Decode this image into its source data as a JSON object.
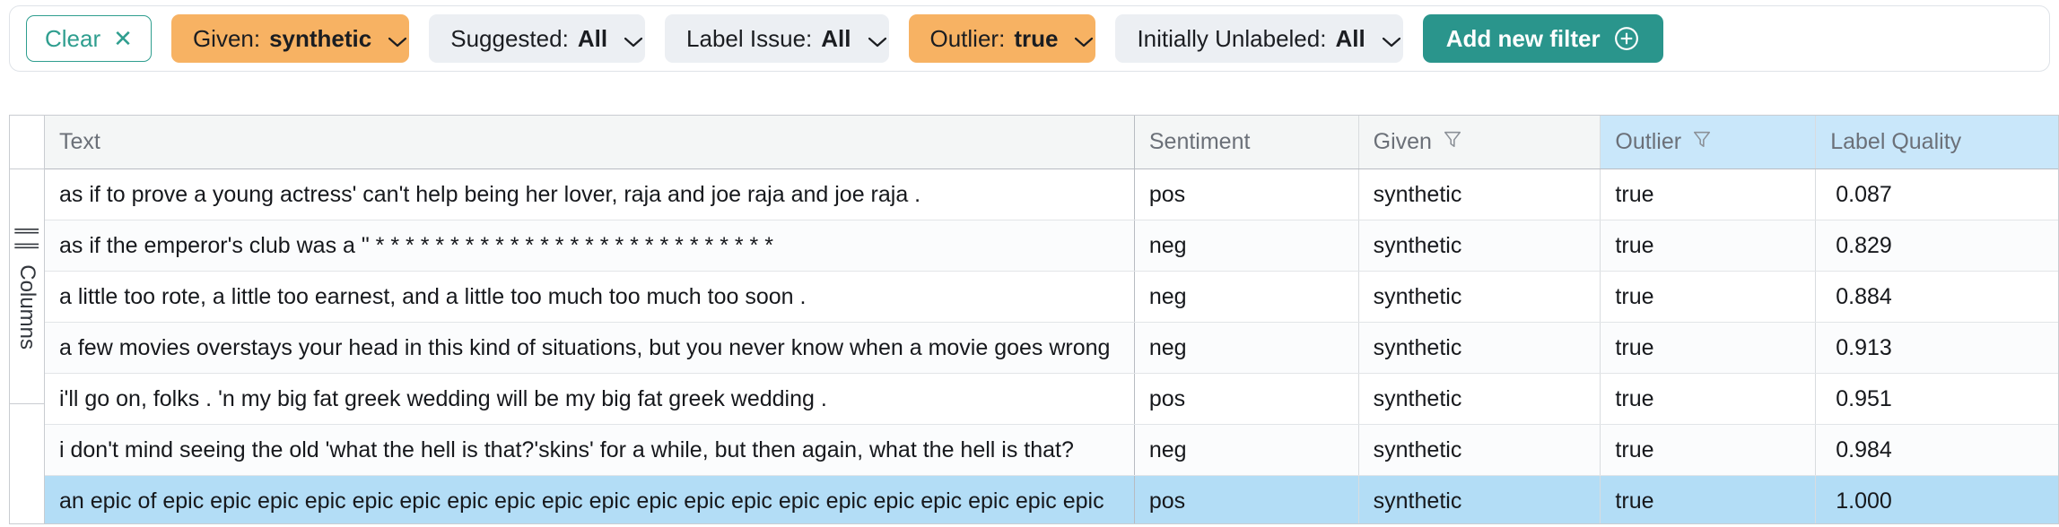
{
  "filter_bar": {
    "clear": {
      "label": "Clear",
      "icon": "close-icon"
    },
    "chips": [
      {
        "label": "Given:",
        "value": "synthetic",
        "state": "active"
      },
      {
        "label": "Suggested:",
        "value": "All",
        "state": "neutral"
      },
      {
        "label": "Label Issue:",
        "value": "All",
        "state": "neutral"
      },
      {
        "label": "Outlier:",
        "value": "true",
        "state": "active"
      },
      {
        "label": "Initially Unlabeled:",
        "value": "All",
        "state": "neutral"
      }
    ],
    "add_filter": {
      "label": "Add new filter",
      "icon": "plus-circle-icon"
    }
  },
  "side_rail": {
    "label": "Columns",
    "icon": "columns-bars-icon"
  },
  "table": {
    "columns": [
      {
        "key": "text",
        "label": "Text",
        "filtered": false,
        "highlighted": false
      },
      {
        "key": "sentiment",
        "label": "Sentiment",
        "filtered": false,
        "highlighted": false
      },
      {
        "key": "given",
        "label": "Given",
        "filtered": true,
        "highlighted": false
      },
      {
        "key": "outlier",
        "label": "Outlier",
        "filtered": true,
        "highlighted": true
      },
      {
        "key": "quality",
        "label": "Label Quality",
        "filtered": false,
        "highlighted": true
      }
    ],
    "rows": [
      {
        "text": "as if to prove a young actress' can't help being her lover, raja and joe raja and joe raja .",
        "sentiment": "pos",
        "given": "synthetic",
        "outlier": "true",
        "quality": "0.087",
        "selected": false
      },
      {
        "text": "as if the emperor's club was a \" * * * * * * * * * * * * * * * * * * * * * * * * * * *",
        "sentiment": "neg",
        "given": "synthetic",
        "outlier": "true",
        "quality": "0.829",
        "selected": false
      },
      {
        "text": "a little too rote, a little too earnest, and a little too much too much too soon .",
        "sentiment": "neg",
        "given": "synthetic",
        "outlier": "true",
        "quality": "0.884",
        "selected": false
      },
      {
        "text": "a few movies overstays your head in this kind of situations, but you never know when a movie goes wrong",
        "sentiment": "neg",
        "given": "synthetic",
        "outlier": "true",
        "quality": "0.913",
        "selected": false
      },
      {
        "text": "i'll go on, folks . 'n my big fat greek wedding will be my big fat greek wedding .",
        "sentiment": "pos",
        "given": "synthetic",
        "outlier": "true",
        "quality": "0.951",
        "selected": false
      },
      {
        "text": "i don't mind seeing the old 'what the hell is that?'skins' for a while, but then again, what the hell is that?",
        "sentiment": "neg",
        "given": "synthetic",
        "outlier": "true",
        "quality": "0.984",
        "selected": false
      },
      {
        "text": "an epic of epic epic epic epic epic epic epic epic epic epic epic epic epic epic epic epic epic epic epic epic",
        "sentiment": "pos",
        "given": "synthetic",
        "outlier": "true",
        "quality": "1.000",
        "selected": true
      }
    ]
  },
  "colors": {
    "accent_teal": "#2a958c",
    "chip_active": "#f7b263",
    "chip_neutral": "#eceff3",
    "selected_row": "#b3ddf6",
    "highlight_header": "#c9e7fa"
  }
}
